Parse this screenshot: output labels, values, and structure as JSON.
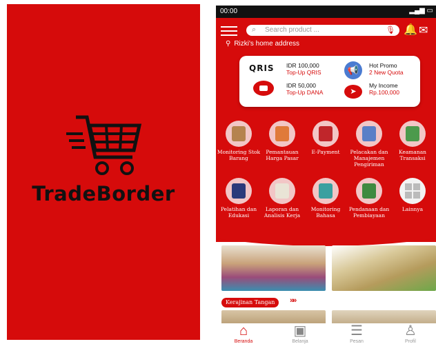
{
  "splash": {
    "brand": "TradeBorder",
    "logo_icon": "shopping-cart-icon",
    "background": "#d60b0b"
  },
  "status_bar": {
    "time": "00:00",
    "signal_icon": "signal-icon",
    "battery_icon": "battery-icon"
  },
  "header": {
    "menu_icon": "hamburger-menu-icon",
    "search_placeholder": "Search product ...",
    "mic_icon": "microphone-icon",
    "bell_icon": "bell-icon",
    "mail_icon": "mail-icon",
    "address": "Rizki's home address"
  },
  "wallet": {
    "qris_logo": "QRIS",
    "qris_amount": "IDR 100,000",
    "qris_label": "Top-Up QRIS",
    "dana_amount": "IDR 50,000",
    "dana_label": "Top-Up DANA",
    "promo_title": "Hot Promo",
    "promo_sub": "2 New Quota",
    "income_title": "My Income",
    "income_value": "Rp.100,000"
  },
  "features": [
    {
      "label": "Monitoring Stok Barang",
      "icon": "warehouse-stock-icon"
    },
    {
      "label": "Pemantauan Harga Pasar",
      "icon": "market-price-chart-icon"
    },
    {
      "label": "E-Payment",
      "icon": "payment-hand-icon"
    },
    {
      "label": "Pelacakan dan Manajemen Pengiriman",
      "icon": "shipping-tracking-icon"
    },
    {
      "label": "Keamanan Transaksi",
      "icon": "security-lock-icon"
    },
    {
      "label": "Pelatihan dan Edukasi",
      "icon": "training-person-icon"
    },
    {
      "label": "Laporan dan Analisis Kerja",
      "icon": "report-analysis-icon"
    },
    {
      "label": "Monitoring Bahasa",
      "icon": "language-monitoring-icon"
    },
    {
      "label": "Pendanaan dan Pembiayaan",
      "icon": "funding-money-icon"
    },
    {
      "label": "Lainnya",
      "icon": "more-grid-icon"
    }
  ],
  "section": {
    "tag": "Kerajinan Tangan",
    "chevron": "»»"
  },
  "bottom_nav": [
    {
      "label": "Beranda",
      "icon": "home-icon",
      "active": true
    },
    {
      "label": "Belanja",
      "icon": "shopping-bag-icon",
      "active": false
    },
    {
      "label": "Pesan",
      "icon": "message-icon",
      "active": false
    },
    {
      "label": "Profil",
      "icon": "profile-icon",
      "active": false
    }
  ],
  "colors": {
    "brand_red": "#d60b0b"
  }
}
